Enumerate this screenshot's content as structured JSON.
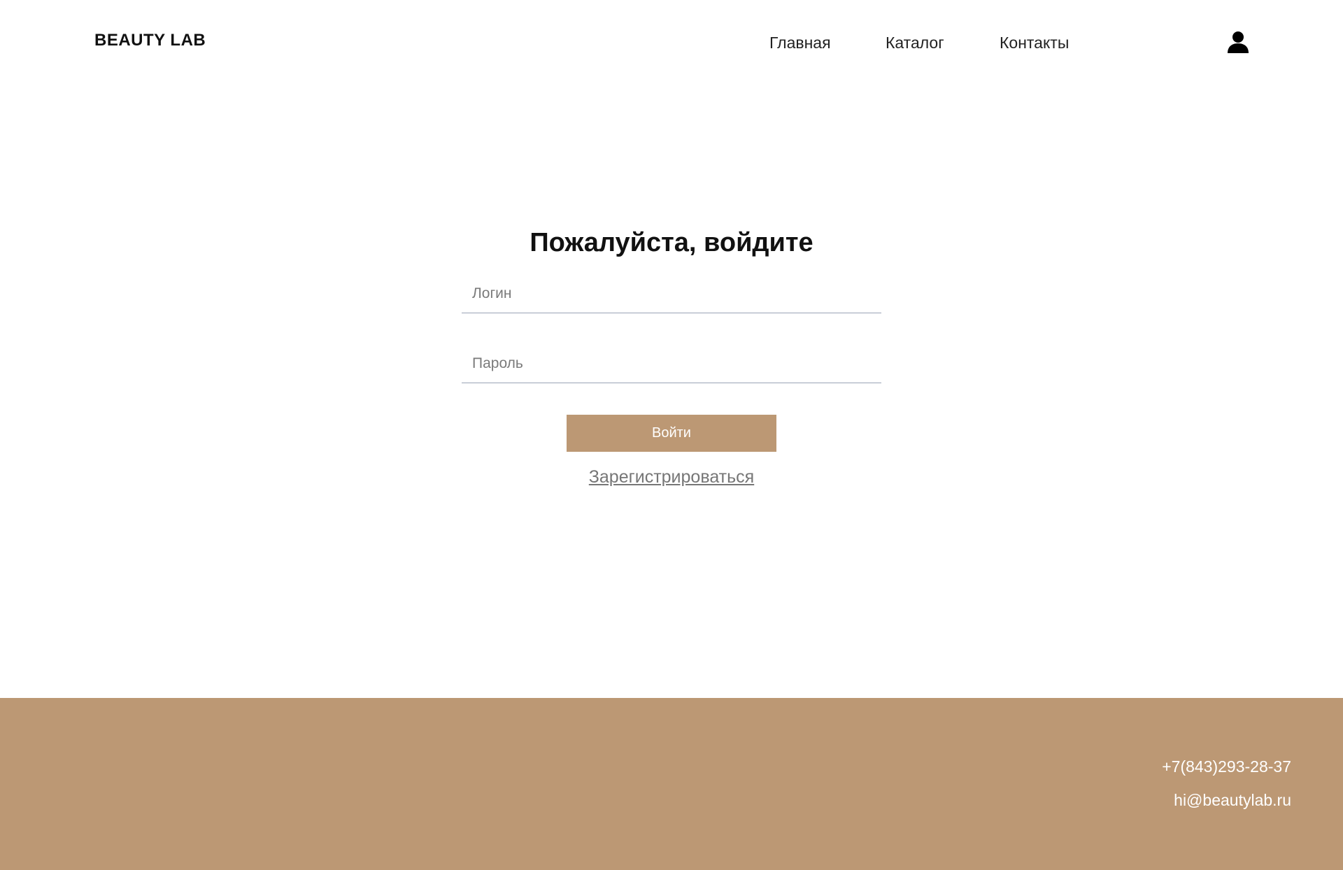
{
  "header": {
    "logo": "BEAUTY LAB",
    "nav": [
      {
        "label": "Главная"
      },
      {
        "label": "Каталог"
      },
      {
        "label": "Контакты"
      }
    ],
    "user_icon": "user-icon"
  },
  "login": {
    "title": "Пожалуйста, войдите",
    "login_placeholder": "Логин",
    "login_value": "",
    "password_placeholder": "Пароль",
    "password_value": "",
    "submit_label": "Войти",
    "register_label": "Зарегистрироваться"
  },
  "footer": {
    "phone": "+7(843)293-28-37",
    "email": "hi@beautylab.ru"
  },
  "colors": {
    "accent": "#bc9874",
    "text": "#111111",
    "muted": "#767676",
    "field_border": "#9aa3b5"
  }
}
